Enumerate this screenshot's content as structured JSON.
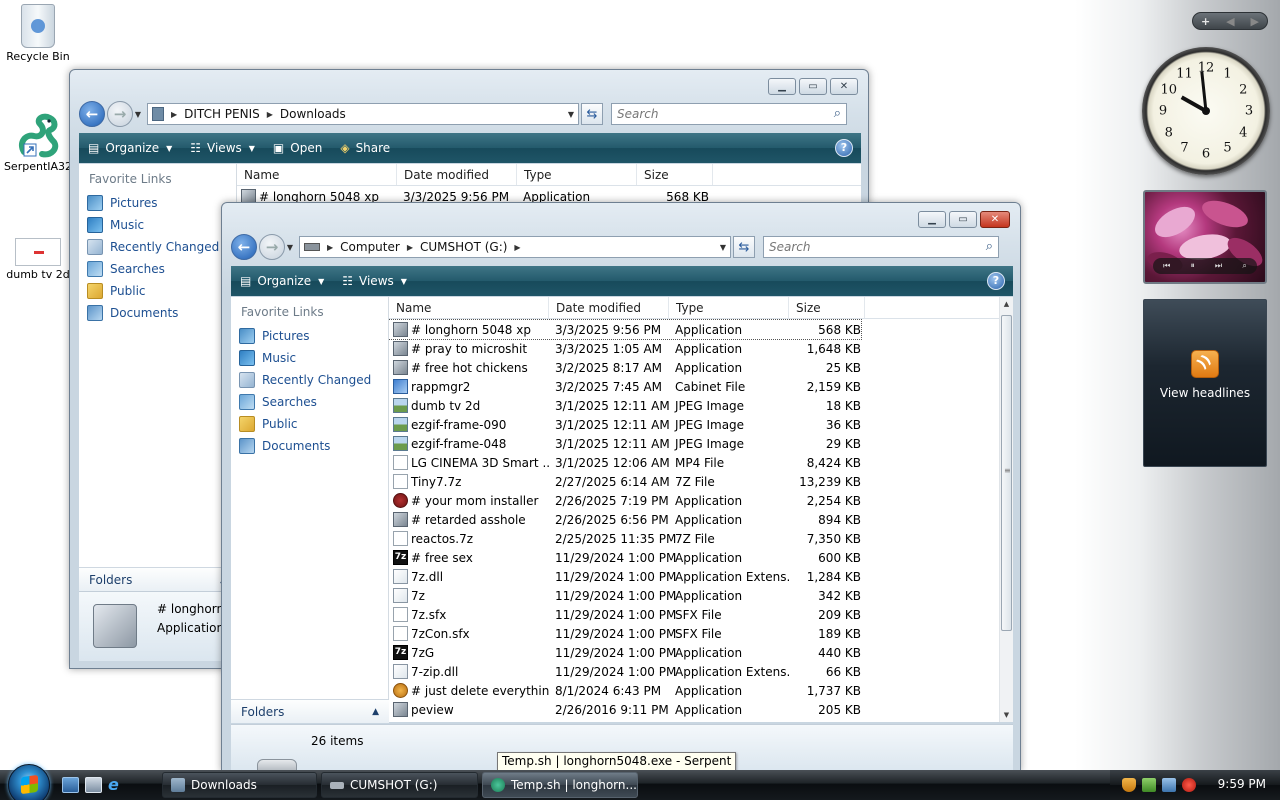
{
  "desktop": {
    "icons": [
      {
        "label": "Recycle Bin"
      },
      {
        "label": "SerpentIA32"
      },
      {
        "label": "dumb tv 2d"
      }
    ]
  },
  "back_window": {
    "path": [
      "DITCH PENIS",
      "Downloads"
    ],
    "search_placeholder": "Search",
    "toolbar": {
      "organize": "Organize",
      "views": "Views",
      "open": "Open",
      "share": "Share"
    },
    "nav_header": "Favorite Links",
    "nav_items": [
      "Pictures",
      "Music",
      "Recently Changed",
      "Searches",
      "Public",
      "Documents"
    ],
    "folders_label": "Folders",
    "columns": [
      "Name",
      "Date modified",
      "Type",
      "Size"
    ],
    "first_row": {
      "name": "# longhorn 5048 xp",
      "date": "3/3/2025 9:56 PM",
      "type": "Application",
      "size": "568 KB"
    },
    "details": {
      "name": "# longhorn",
      "type": "Application"
    }
  },
  "front_window": {
    "path": [
      "Computer",
      "CUMSHOT (G:)"
    ],
    "search_placeholder": "Search",
    "toolbar": {
      "organize": "Organize",
      "views": "Views"
    },
    "nav_header": "Favorite Links",
    "nav_items": [
      "Pictures",
      "Music",
      "Recently Changed",
      "Searches",
      "Public",
      "Documents"
    ],
    "folders_label": "Folders",
    "columns": [
      "Name",
      "Date modified",
      "Type",
      "Size"
    ],
    "files": [
      {
        "name": "# longhorn 5048 xp",
        "date": "3/3/2025 9:56 PM",
        "type": "Application",
        "size": "568 KB",
        "icon": "app"
      },
      {
        "name": "# pray to microshit",
        "date": "3/3/2025 1:05 AM",
        "type": "Application",
        "size": "1,648 KB",
        "icon": "app"
      },
      {
        "name": "# free hot chickens",
        "date": "3/2/2025 8:17 AM",
        "type": "Application",
        "size": "25 KB",
        "icon": "app"
      },
      {
        "name": "rappmgr2",
        "date": "3/2/2025 7:45 AM",
        "type": "Cabinet File",
        "size": "2,159 KB",
        "icon": "cab"
      },
      {
        "name": "dumb tv 2d",
        "date": "3/1/2025 12:11 AM",
        "type": "JPEG Image",
        "size": "18 KB",
        "icon": "img"
      },
      {
        "name": "ezgif-frame-090",
        "date": "3/1/2025 12:11 AM",
        "type": "JPEG Image",
        "size": "36 KB",
        "icon": "img"
      },
      {
        "name": "ezgif-frame-048",
        "date": "3/1/2025 12:11 AM",
        "type": "JPEG Image",
        "size": "29 KB",
        "icon": "img"
      },
      {
        "name": "LG CINEMA 3D Smart ...",
        "date": "3/1/2025 12:06 AM",
        "type": "MP4 File",
        "size": "8,424 KB",
        "icon": "file"
      },
      {
        "name": "Tiny7.7z",
        "date": "2/27/2025 6:14 AM",
        "type": "7Z File",
        "size": "13,239 KB",
        "icon": "file"
      },
      {
        "name": "# your mom installer",
        "date": "2/26/2025 7:19 PM",
        "type": "Application",
        "size": "2,254 KB",
        "icon": "mom"
      },
      {
        "name": "# retarded asshole",
        "date": "2/26/2025 6:56 PM",
        "type": "Application",
        "size": "894 KB",
        "icon": "app"
      },
      {
        "name": "reactos.7z",
        "date": "2/25/2025 11:35 PM",
        "type": "7Z File",
        "size": "7,350 KB",
        "icon": "file"
      },
      {
        "name": "# free sex",
        "date": "11/29/2024 1:00 PM",
        "type": "Application",
        "size": "600 KB",
        "icon": "sz"
      },
      {
        "name": "7z.dll",
        "date": "11/29/2024 1:00 PM",
        "type": "Application Extens...",
        "size": "1,284 KB",
        "icon": "dll"
      },
      {
        "name": "7z",
        "date": "11/29/2024 1:00 PM",
        "type": "Application",
        "size": "342 KB",
        "icon": "dll"
      },
      {
        "name": "7z.sfx",
        "date": "11/29/2024 1:00 PM",
        "type": "SFX File",
        "size": "209 KB",
        "icon": "file"
      },
      {
        "name": "7zCon.sfx",
        "date": "11/29/2024 1:00 PM",
        "type": "SFX File",
        "size": "189 KB",
        "icon": "file"
      },
      {
        "name": "7zG",
        "date": "11/29/2024 1:00 PM",
        "type": "Application",
        "size": "440 KB",
        "icon": "sz"
      },
      {
        "name": "7-zip.dll",
        "date": "11/29/2024 1:00 PM",
        "type": "Application Extens...",
        "size": "66 KB",
        "icon": "dll"
      },
      {
        "name": "# just delete everything",
        "date": "8/1/2024 6:43 PM",
        "type": "Application",
        "size": "1,737 KB",
        "icon": "key"
      },
      {
        "name": "peview",
        "date": "2/26/2016 9:11 PM",
        "type": "Application",
        "size": "205 KB",
        "icon": "app"
      }
    ],
    "item_count": "26 items"
  },
  "tooltip": "Temp.sh | longhorn5048.exe - Serpent",
  "taskbar": {
    "buttons": [
      "Downloads",
      "CUMSHOT (G:)",
      "Temp.sh | longhorn..."
    ],
    "active_index": 2,
    "clock": "9:59 PM"
  },
  "sidebar": {
    "control_plus": "+",
    "analog_clock": {
      "hours": 9,
      "minutes": 59
    },
    "feed_label": "View headlines"
  }
}
